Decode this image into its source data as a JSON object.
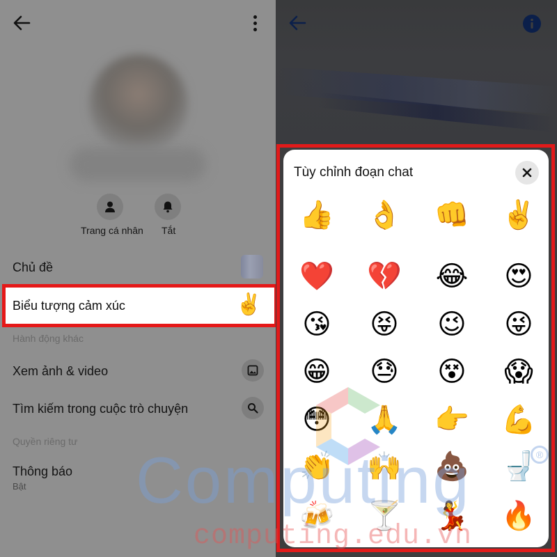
{
  "left_panel": {
    "quick_actions": [
      {
        "label": "Trang cá nhân",
        "icon": "person-icon"
      },
      {
        "label": "Tắt",
        "icon": "bell-icon"
      }
    ],
    "rows": {
      "theme": {
        "label": "Chủ đề"
      },
      "emoji": {
        "label": "Biểu tượng cảm xúc",
        "value": "✌️"
      },
      "more_actions_header": "Hành động khác",
      "media": {
        "label": "Xem ảnh & video",
        "icon": "image-icon"
      },
      "search": {
        "label": "Tìm kiếm trong cuộc trò chuyện",
        "icon": "search-icon"
      },
      "privacy_header": "Quyền riêng tư",
      "notifications": {
        "label": "Thông báo",
        "value": "Bật"
      }
    }
  },
  "sheet": {
    "title": "Tùy chỉnh đoạn chat",
    "emojis": [
      "👍",
      "👌",
      "👊",
      "✌️",
      "❤️",
      "💔",
      "😂",
      "😍",
      "😘",
      "😝",
      "😉",
      "😜",
      "😁",
      "😓",
      "😵",
      "😱",
      "😳",
      "🙏",
      "👉",
      "💪",
      "👏",
      "🙌",
      "💩",
      "🚽",
      "🍻",
      "🍸",
      "💃",
      "🔥"
    ]
  },
  "watermark": {
    "brand": "Computing",
    "registered": "®",
    "url": "computing.edu.vn"
  },
  "colors": {
    "highlight_border": "#e51818",
    "dim_overlay_left": "#8f8f8f",
    "dim_overlay_right": "#3d3d3e"
  }
}
